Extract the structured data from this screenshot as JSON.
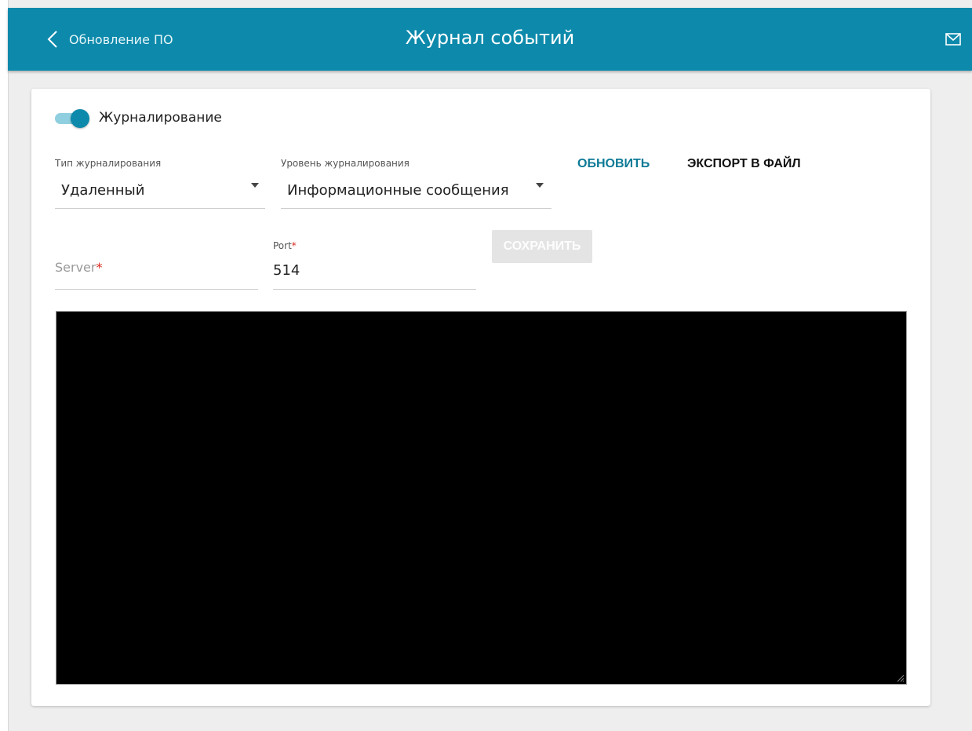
{
  "header": {
    "back_label": "Обновление ПО",
    "title": "Журнал событий",
    "accent_color": "#0d8aab"
  },
  "logging": {
    "toggle_label": "Журналирование",
    "enabled": true,
    "type": {
      "label": "Тип журналирования",
      "value": "Удаленный"
    },
    "level": {
      "label": "Уровень журналирования",
      "value": "Информационные сообщения"
    },
    "refresh_label": "ОБНОВИТЬ",
    "export_label": "ЭКСПОРТ В ФАЙЛ"
  },
  "remote": {
    "server": {
      "label": "Server",
      "required_mark": "*",
      "value": ""
    },
    "port": {
      "label": "Port",
      "required_mark": "*",
      "value": "514"
    },
    "save_label": "СОХРАНИТЬ"
  },
  "log_output": {
    "content": ""
  },
  "icons": {
    "back": "chevron-left-icon",
    "mail": "mail-icon",
    "dropdown": "caret-down-icon",
    "resize": "resize-grip-icon"
  }
}
